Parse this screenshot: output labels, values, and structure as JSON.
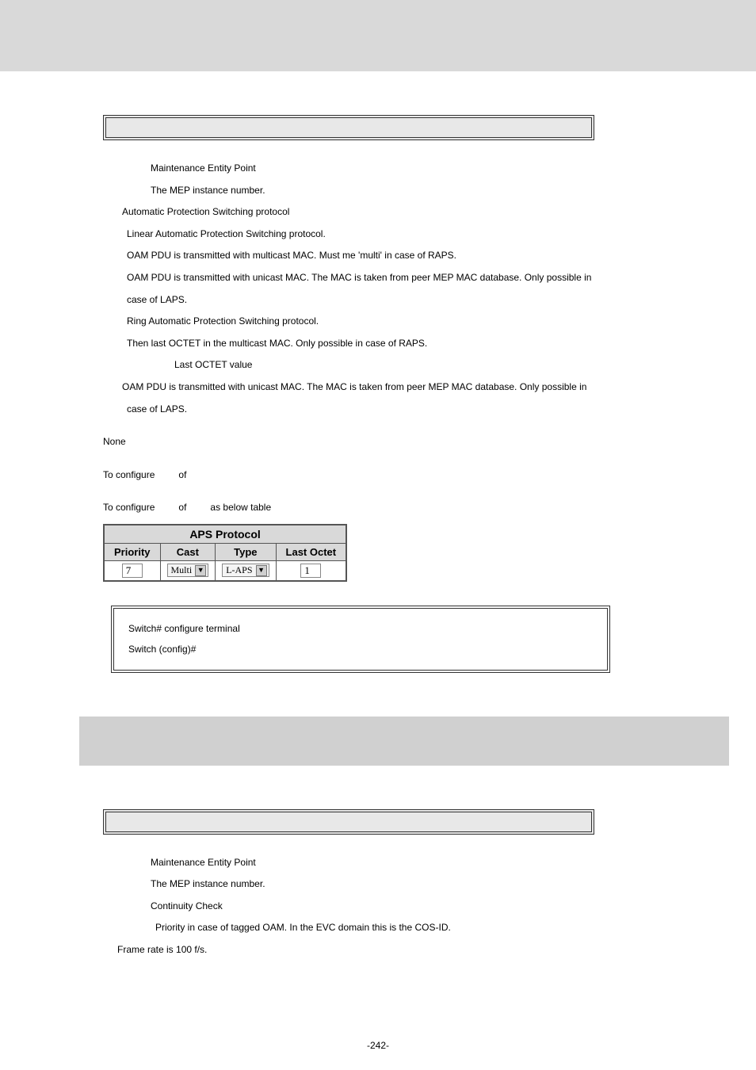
{
  "defs1": {
    "mep_label": "Maintenance Entity Point",
    "instance": "The MEP instance number.",
    "aps_label": "Automatic Protection Switching protocol",
    "linear": "Linear Automatic Protection Switching protocol.",
    "multicast": "OAM PDU is transmitted with multicast MAC. Must me 'multi' in case of RAPS.",
    "unicast1": "OAM PDU is transmitted  with unicast MAC.  The MAC is  taken from peer MEP  MAC database.  Only possible in",
    "unicast1b": "case of LAPS.",
    "ring": "Ring Automatic Protection Switching protocol.",
    "lastoctet_intro": "Then last OCTET in the multicast MAC. Only possible in case of RAPS.",
    "lastoctet_label": "Last OCTET value",
    "unicast2": "OAM PDU is transmitted  with unicast MAC.  The MAC is  taken from peer MEP  MAC database.  Only possible in",
    "unicast2b": "case of LAPS."
  },
  "none": "None",
  "toconf1_a": "To configure",
  "toconf1_b": "of",
  "toconf2_a": "To configure",
  "toconf2_b": "of",
  "toconf2_c": "as below table",
  "aps_table": {
    "title": "APS Protocol",
    "headers": [
      "Priority",
      "Cast",
      "Type",
      "Last Octet"
    ],
    "row": {
      "priority": "7",
      "cast": "Multi",
      "type": "L-APS",
      "last_octet": "1"
    }
  },
  "cli": {
    "line1": "Switch# configure terminal",
    "line2": "Switch (config)#"
  },
  "defs2": {
    "mep_label": "Maintenance Entity Point",
    "instance": "The MEP instance number.",
    "cc_label": "Continuity Check",
    "priority": "Priority in case of tagged OAM. In the EVC domain this is the COS-ID.",
    "frame_rate": "Frame rate is 100 f/s."
  },
  "pagenum": "-242-"
}
